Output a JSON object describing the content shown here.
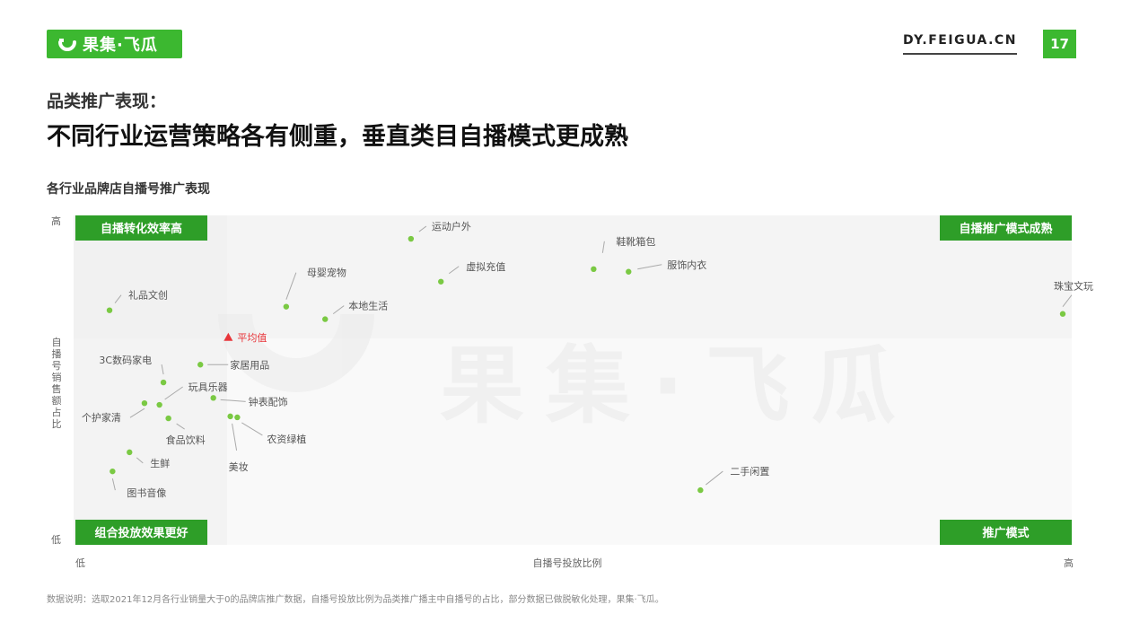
{
  "brand": {
    "name": "果集·飞瓜",
    "site": "DY.FEIGUA.CN",
    "page": "17",
    "accent": "#3cb830"
  },
  "heading": {
    "kicker": "品类推广表现：",
    "title": "不同行业运营策略各有侧重，垂直类目自播模式更成熟"
  },
  "chart_title": "各行业品牌店自播号推广表现",
  "chart_data": {
    "type": "scatter",
    "title": "各行业品牌店自播号推广表现",
    "xlabel": "自播号投放比例",
    "ylabel": "自播号销售额占比",
    "x_low": "低",
    "x_high": "高",
    "y_low": "低",
    "y_high": "高",
    "xlim": [
      0,
      100
    ],
    "ylim": [
      0,
      100
    ],
    "grid": false,
    "average": {
      "label": "平均值",
      "x": 15.5,
      "y": 63
    },
    "quadrants": [
      {
        "label": "自播转化效率高",
        "position": "top-left"
      },
      {
        "label": "自播推广模式成熟",
        "position": "top-right"
      },
      {
        "label": "组合投放效果更好",
        "position": "bottom-left"
      },
      {
        "label": "推广模式",
        "position": "bottom-right"
      }
    ],
    "points": [
      {
        "name": "运动户外",
        "x": 33.8,
        "y": 92.9
      },
      {
        "name": "鞋靴箱包",
        "x": 52.1,
        "y": 83.7
      },
      {
        "name": "服饰内衣",
        "x": 55.6,
        "y": 82.9
      },
      {
        "name": "虚拟充值",
        "x": 36.8,
        "y": 79.9
      },
      {
        "name": "珠宝文玩",
        "x": 99.1,
        "y": 70.1
      },
      {
        "name": "礼品文创",
        "x": 3.6,
        "y": 71.2
      },
      {
        "name": "母婴宠物",
        "x": 21.3,
        "y": 72.3
      },
      {
        "name": "本地生活",
        "x": 25.2,
        "y": 68.5
      },
      {
        "name": "3C数码家电",
        "x": 9.0,
        "y": 49.3
      },
      {
        "name": "家居用品",
        "x": 12.7,
        "y": 54.7
      },
      {
        "name": "玩具乐器",
        "x": 8.6,
        "y": 42.5
      },
      {
        "name": "钟表配饰",
        "x": 14.0,
        "y": 44.6
      },
      {
        "name": "个护家清",
        "x": 7.1,
        "y": 43.0
      },
      {
        "name": "食品饮料",
        "x": 9.5,
        "y": 38.4
      },
      {
        "name": "农资绿植",
        "x": 16.4,
        "y": 38.7
      },
      {
        "name": "美妆",
        "x": 15.7,
        "y": 39.0
      },
      {
        "name": "生鲜",
        "x": 5.6,
        "y": 28.1
      },
      {
        "name": "图书音像",
        "x": 3.9,
        "y": 22.3
      },
      {
        "name": "二手闲置",
        "x": 62.8,
        "y": 16.6
      }
    ],
    "colors": {
      "point": "#7ac943",
      "average": "#e8353a",
      "quadrant_label_bg": "#2e9e28"
    }
  },
  "footnote": "数据说明：选取2021年12月各行业销量大于0的品牌店推广数据，自播号投放比例为品类推广播主中自播号的占比，部分数据已做脱敏化处理，果集·飞瓜。",
  "watermark": "果集·飞瓜"
}
